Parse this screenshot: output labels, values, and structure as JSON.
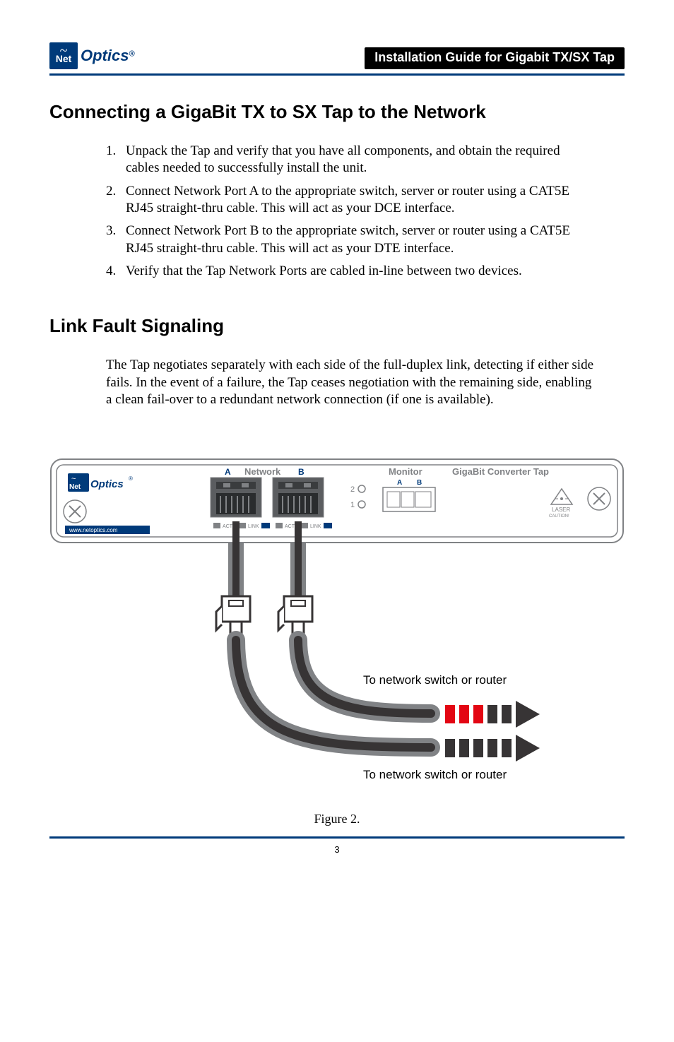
{
  "header": {
    "logo_net": "Net",
    "logo_optics": "Optics",
    "title_pill": "Installation Guide for Gigabit TX/SX Tap"
  },
  "section1": {
    "heading": "Connecting a GigaBit TX to SX Tap to the Network",
    "steps": [
      "Unpack the Tap and verify that you have all components, and obtain the required cables needed to successfully install the unit.",
      "Connect Network Port A to the appropriate switch, server or router using a CAT5E RJ45 straight-thru cable. This will act as your DCE interface.",
      "Connect Network Port B to the appropriate switch, server or router using a CAT5E RJ45 straight-thru cable. This will act as your DTE interface.",
      "Verify that the Tap Network Ports are cabled in-line between two devices."
    ]
  },
  "section2": {
    "heading": "Link Fault Signaling",
    "body": "The Tap negotiates separately with each side of the full-duplex link, detecting if either side fails. In the event of a failure, the Tap ceases negotiation with the remaining side, enabling a clean fail-over to a redundant network connection (if one is available)."
  },
  "figure": {
    "device_logo_net": "Net",
    "device_logo_optics": "Optics",
    "device_url": "www.netoptics.com",
    "port_a": "A",
    "port_b": "B",
    "network_label": "Network",
    "monitor_label": "Monitor",
    "monitor_a": "A",
    "monitor_b": "B",
    "device_title": "GigaBit Converter Tap",
    "led_2": "2",
    "led_1": "1",
    "act_a": "ACT",
    "link_a": "LINK",
    "act_b": "ACT",
    "link_b": "LINK",
    "laser_top": "LASER",
    "laser_bottom": "CAUTION!",
    "caption_right": "To network switch or router",
    "caption_bottom": "To network switch or router",
    "figure_label": "Figure 2."
  },
  "page_number": "3"
}
